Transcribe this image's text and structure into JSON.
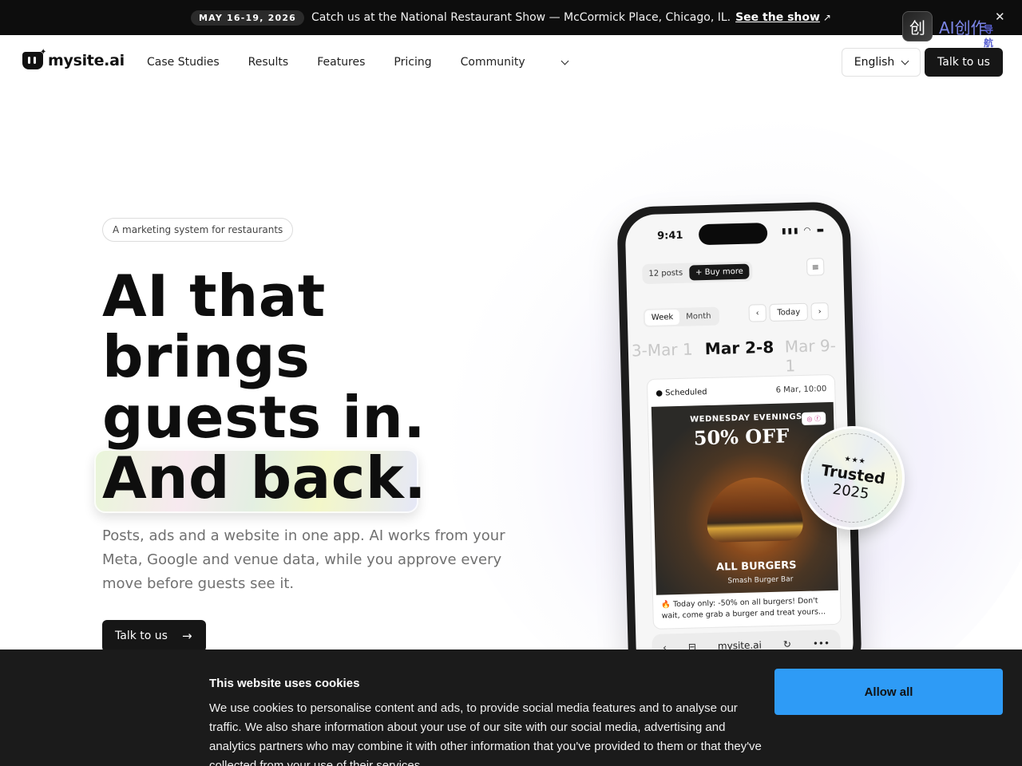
{
  "announcement": {
    "date": "MAY 16-19, 2026",
    "message": "Catch us at the National Restaurant Show — McCormick Place, Chicago, IL.",
    "link": "See the show",
    "link_icon": "↗"
  },
  "extension": {
    "logo_glyph": "创",
    "name": "AI创作",
    "sub": "导航",
    "close": "✕"
  },
  "nav": {
    "logo_text": "mysite.ai",
    "links": [
      "Case Studies",
      "Results",
      "Features",
      "Pricing",
      "Community"
    ],
    "language": "English",
    "talk": "Talk to us"
  },
  "hero": {
    "tag": "A marketing system for restaurants",
    "headline": [
      "AI that",
      "brings",
      "guests in.",
      "And back."
    ],
    "subtext": "Posts, ads and a website in one app. AI works from your Meta, Google and venue data, while you approve every move before guests see it.",
    "cta": "Talk to us",
    "cta_icon": "→"
  },
  "phone": {
    "time": "9:41",
    "status": "▮▮▮ ◠ ▬",
    "posts": "12 posts",
    "buy_more": "+  Buy more",
    "menu_icon": "≡",
    "view_week": "Week",
    "view_month": "Month",
    "prev_icon": "‹",
    "today": "Today",
    "next_icon": "›",
    "week_prev": "3-Mar 1",
    "week_current": "Mar 2-8",
    "week_next": "Mar 9-1",
    "post_status": "● Scheduled",
    "post_time": "6 Mar, 10:00",
    "social_icons": "◎ ⓕ",
    "promo_line1": "WEDNESDAY EVENINGS",
    "promo_line2": "50% OFF",
    "promo_line3": "ALL BURGERS",
    "promo_line4": "Smash Burger Bar",
    "caption": "🔥 Today only: -50% on all burgers! Don't wait, come grab a burger and treat yours...",
    "browser_back": "‹",
    "browser_tabs": "⊟",
    "browser_url": "mysite.ai",
    "browser_reload": "↻",
    "browser_more": "•••"
  },
  "badge": {
    "stars": "★★★",
    "title": "Trusted",
    "year": "2025",
    "ring_text": "BEST SOCIAL MEDIA ASSISTANT 2025"
  },
  "cookie": {
    "title": "This website uses cookies",
    "body": "We use cookies to personalise content and ads, to provide social media features and to analyse our traffic. We also share information about your use of our site with our social media, advertising and analytics partners who may combine it with other information that you've provided to them or that they've collected from your use of their services.",
    "allow": "Allow all"
  }
}
